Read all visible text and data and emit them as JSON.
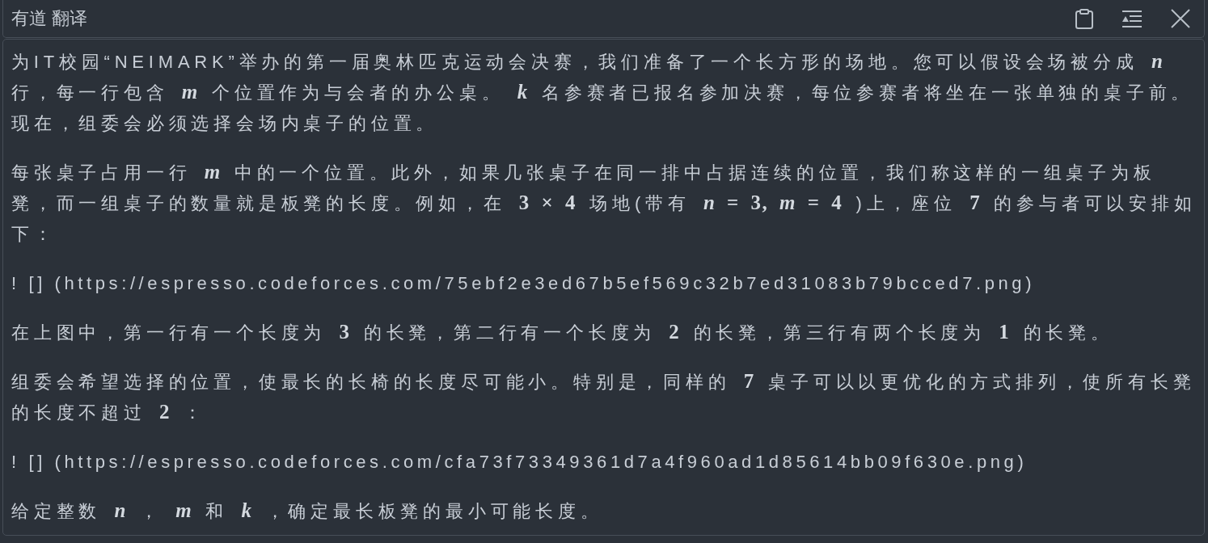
{
  "window": {
    "title": "有道 翻译"
  },
  "translation": {
    "paragraphs": [
      {
        "kind": "prose",
        "segments": [
          {
            "kind": "text",
            "text": "为IT校园“NEIMARK”举办的第一届奥林匹克运动会决赛，我们准备了一个长方形的场地。您可以假设会场被分成"
          },
          {
            "kind": "var",
            "text": "n"
          },
          {
            "kind": "text",
            "text": "行，每一行包含"
          },
          {
            "kind": "var",
            "text": "m"
          },
          {
            "kind": "text",
            "text": "个位置作为与会者的办公桌。"
          },
          {
            "kind": "var",
            "text": "k"
          },
          {
            "kind": "text",
            "text": "名参赛者已报名参加决赛，每位参赛者将坐在一张单独的桌子前。现在，组委会必须选择会场内桌子的位置。"
          }
        ]
      },
      {
        "kind": "prose",
        "segments": [
          {
            "kind": "text",
            "text": "每张桌子占用一行"
          },
          {
            "kind": "var",
            "text": "m"
          },
          {
            "kind": "text",
            "text": "中的一个位置。此外，如果几张桌子在同一排中占据连续的位置，我们称这样的一组桌子为板凳，而一组桌子的数量就是板凳的长度。例如，在"
          },
          {
            "kind": "num",
            "text": "3 × 4"
          },
          {
            "kind": "text",
            "text": "场地(带有"
          },
          {
            "kind": "expr",
            "text": "*n* = 3, *m* = 4"
          },
          {
            "kind": "text",
            "text": ")上，座位"
          },
          {
            "kind": "num",
            "text": "7"
          },
          {
            "kind": "text",
            "text": "的参与者可以安排如下："
          }
        ]
      },
      {
        "kind": "image_ref",
        "text": "! [] (https://espresso.codeforces.com/75ebf2e3ed67b5ef569c32b7ed31083b79bcced7.png)"
      },
      {
        "kind": "prose",
        "segments": [
          {
            "kind": "text",
            "text": "在上图中，第一行有一个长度为"
          },
          {
            "kind": "num",
            "text": "3"
          },
          {
            "kind": "text",
            "text": "的长凳，第二行有一个长度为"
          },
          {
            "kind": "num",
            "text": "2"
          },
          {
            "kind": "text",
            "text": "的长凳，第三行有两个长度为"
          },
          {
            "kind": "num",
            "text": "1"
          },
          {
            "kind": "text",
            "text": "的长凳。"
          }
        ]
      },
      {
        "kind": "prose",
        "segments": [
          {
            "kind": "text",
            "text": "组委会希望选择的位置，使最长的长椅的长度尽可能小。特别是，同样的"
          },
          {
            "kind": "num",
            "text": "7"
          },
          {
            "kind": "text",
            "text": "桌子可以以更优化的方式排列，使所有长凳的长度不超过"
          },
          {
            "kind": "num",
            "text": "2"
          },
          {
            "kind": "text",
            "text": "："
          }
        ]
      },
      {
        "kind": "image_ref",
        "text": "! [] (https://espresso.codeforces.com/cfa73f73349361d7a4f960ad1d85614bb09f630e.png)"
      },
      {
        "kind": "prose",
        "segments": [
          {
            "kind": "text",
            "text": "给定整数"
          },
          {
            "kind": "var",
            "text": "n"
          },
          {
            "kind": "text",
            "text": "，"
          },
          {
            "kind": "var",
            "text": "m"
          },
          {
            "kind": "text",
            "text": "和"
          },
          {
            "kind": "var",
            "text": "k"
          },
          {
            "kind": "text",
            "text": "，确定最长板凳的最小可能长度。"
          }
        ]
      }
    ]
  }
}
